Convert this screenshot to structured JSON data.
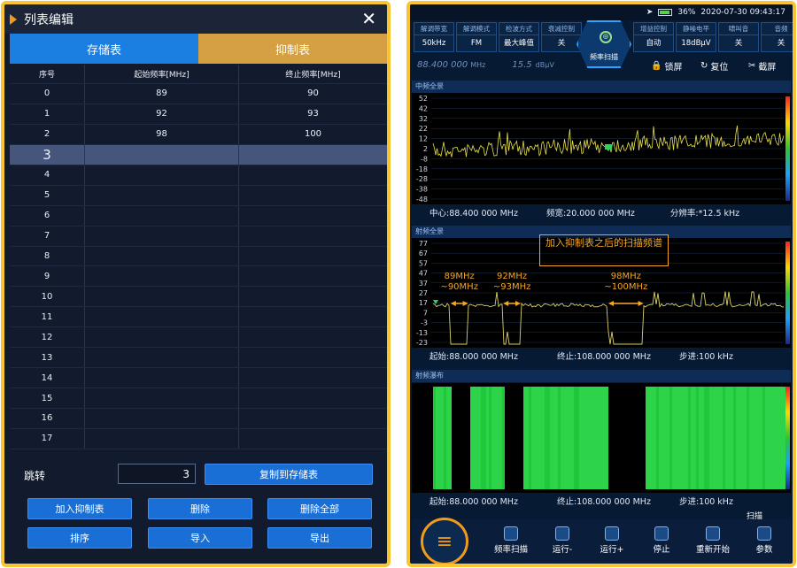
{
  "left": {
    "title": "列表编辑",
    "close_icon": "close-icon",
    "tabs": [
      "存储表",
      "抑制表"
    ],
    "headers": [
      "序号",
      "起始频率[MHz]",
      "终止频率[MHz]"
    ],
    "rows": [
      [
        "0",
        "89",
        "90"
      ],
      [
        "1",
        "92",
        "93"
      ],
      [
        "2",
        "98",
        "100"
      ],
      [
        "3",
        "",
        ""
      ],
      [
        "4",
        "",
        ""
      ],
      [
        "5",
        "",
        ""
      ],
      [
        "6",
        "",
        ""
      ],
      [
        "7",
        "",
        ""
      ],
      [
        "8",
        "",
        ""
      ],
      [
        "9",
        "",
        ""
      ],
      [
        "10",
        "",
        ""
      ],
      [
        "11",
        "",
        ""
      ],
      [
        "12",
        "",
        ""
      ],
      [
        "13",
        "",
        ""
      ],
      [
        "14",
        "",
        ""
      ],
      [
        "15",
        "",
        ""
      ],
      [
        "16",
        "",
        ""
      ],
      [
        "17",
        "",
        ""
      ]
    ],
    "selected_row": 3,
    "jump_label": "跳转",
    "jump_value": "3",
    "copy_button": "复制到存储表",
    "buttons": [
      "加入抑制表",
      "删除",
      "删除全部",
      "排序",
      "导入",
      "导出"
    ]
  },
  "right": {
    "status": {
      "battery": "36%",
      "datetime": "2020-07-30  09:43:17"
    },
    "params": [
      {
        "label": "解调带宽",
        "value": "50kHz"
      },
      {
        "label": "解调模式",
        "value": "FM"
      },
      {
        "label": "检波方式",
        "value": "最大峰值"
      },
      {
        "label": "衰减控制",
        "value": "关"
      },
      {
        "label": "增益控制",
        "value": "自动"
      },
      {
        "label": "静噪电平",
        "value": "18dBμV"
      },
      {
        "label": "啸叫音",
        "value": "关"
      },
      {
        "label": "音频",
        "value": "关"
      }
    ],
    "scan_mode": "频率扫描",
    "freq_readout": "88.400 000",
    "freq_unit": "MHz",
    "level_readout": "15.5",
    "level_unit": "dBμV",
    "tools": [
      "锁屏",
      "复位",
      "截屏"
    ],
    "panel1": {
      "title": "中频全景",
      "yticks": [
        "52",
        "42",
        "32",
        "22",
        "12",
        "2",
        "-8",
        "-18",
        "-28",
        "-38",
        "-48"
      ],
      "info": [
        "中心:88.400 000 MHz",
        "频宽:20.000 000 MHz",
        "分辨率:*12.5 kHz"
      ]
    },
    "panel2": {
      "title": "射频全景",
      "yticks": [
        "77",
        "67",
        "57",
        "47",
        "37",
        "27",
        "17",
        "7",
        "-3",
        "-13",
        "-23"
      ],
      "note": "加入抑制表之后的扫描频谱",
      "ann": [
        "89MHz\n~90MHz",
        "92MHz\n~93MHz",
        "98MHz\n~100MHz"
      ],
      "info": [
        "起始:88.000 000 MHz",
        "终止:108.000 000 MHz",
        "步进:100 kHz"
      ]
    },
    "panel3": {
      "title": "射频瀑布",
      "info": [
        "起始:88.000 000 MHz",
        "终止:108.000 000 MHz",
        "步进:100 kHz"
      ]
    },
    "scan_tab": "扫描",
    "bottom": [
      "频率扫描",
      "运行-",
      "运行+",
      "停止",
      "重新开始",
      "参数"
    ]
  }
}
